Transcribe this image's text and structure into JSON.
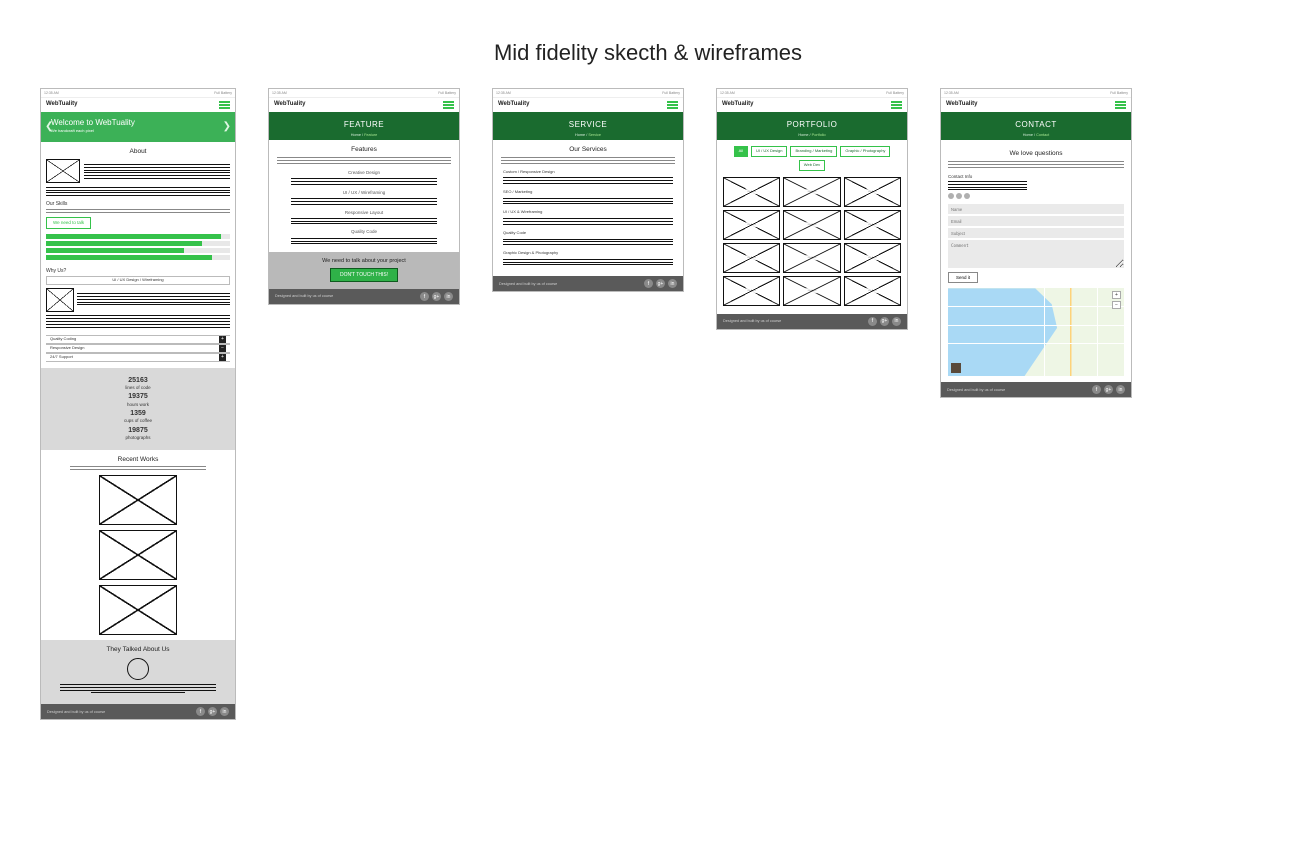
{
  "title": "Mid fidelity skecth & wireframes",
  "status": {
    "left": "12:35 AM",
    "right": "Full Battery"
  },
  "brand": "WebTuality",
  "home": {
    "hero": {
      "headline": "Welcome to WebTuality",
      "sub": "We handcraft each pixel"
    },
    "about_h": "About",
    "skills_h": "Our Skills",
    "talk_btn": "We need to talk",
    "skill_pcts": [
      95,
      85,
      75,
      90
    ],
    "why_h": "Why Us?",
    "why_tab_mid": "UI / UX Design / Wireframing",
    "tabs": [
      "Quality Coding",
      "Responsive Design",
      "24/7 Support"
    ],
    "stats": [
      {
        "n": "25163",
        "l": "lines of code"
      },
      {
        "n": "19375",
        "l": "hours work"
      },
      {
        "n": "1359",
        "l": "cups of coffee"
      },
      {
        "n": "19875",
        "l": "photographs"
      }
    ],
    "recent_h": "Recent Works",
    "testi_h": "They Talked About Us"
  },
  "feature": {
    "pg": "FEATURE",
    "crumb_home": "Home / ",
    "crumb_here": "Feature",
    "sub": "Features",
    "items": [
      "Creative Design",
      "UI / UX / Wireframing",
      "Responsive Layout",
      "Quality Code"
    ],
    "cta_text": "We need to talk about your project",
    "cta_btn": "DON'T TOUCH THIS!"
  },
  "service": {
    "pg": "SERVICE",
    "crumb_home": "Home / ",
    "crumb_here": "Service",
    "sub": "Our Services",
    "items": [
      "Custom / Responsive Design",
      "SEO / Marketing",
      "UI / UX & Wireframing",
      "Quality Code",
      "Graphic Design & Photography"
    ]
  },
  "portfolio": {
    "pg": "PORTFOLIO",
    "crumb_home": "Home / ",
    "crumb_here": "Portfolio",
    "filters": [
      "All",
      "UI / UX Design",
      "Branding / Marketing",
      "Graphic / Photography",
      "Web Dev"
    ]
  },
  "contact": {
    "pg": "CONTACT",
    "crumb_home": "Home / ",
    "crumb_here": "Contact",
    "sub": "We love questions",
    "info_h": "Contact Info",
    "fields": {
      "name": "Name",
      "email": "Email",
      "subject": "Subject",
      "comment": "Comment"
    },
    "send": "Send it"
  },
  "footer_text": "Designed and built by us of course",
  "socials": [
    "f",
    "g+",
    "in"
  ]
}
